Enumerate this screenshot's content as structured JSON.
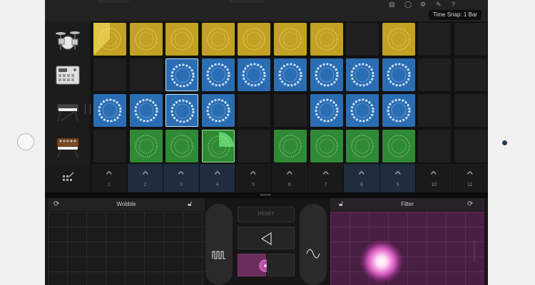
{
  "toolbar": {
    "time_snap_label": "Time Snap: 1 Bar",
    "icons": [
      "mixer-icon",
      "loops-icon",
      "settings-icon",
      "wrench-icon",
      "help-icon"
    ]
  },
  "instruments": [
    {
      "name": "drum-kit"
    },
    {
      "name": "beat-sequencer"
    },
    {
      "name": "electric-piano"
    },
    {
      "name": "synthesizer"
    }
  ],
  "grid": {
    "rows": [
      [
        "yellow-playing",
        "yellow",
        "yellow",
        "yellow",
        "yellow",
        "yellow",
        "yellow",
        "empty",
        "yellow",
        "empty",
        "empty"
      ],
      [
        "empty",
        "empty",
        "blue-playing",
        "blue",
        "blue",
        "blue",
        "blue",
        "blue",
        "blue",
        "empty",
        "empty"
      ],
      [
        "blue",
        "blue",
        "blue-playing",
        "blue",
        "empty",
        "empty",
        "blue",
        "blue",
        "blue",
        "empty",
        "empty"
      ],
      [
        "empty",
        "green",
        "green",
        "green-selected",
        "empty",
        "green",
        "green",
        "green",
        "green",
        "empty",
        "empty"
      ]
    ]
  },
  "triggers": {
    "numbers": [
      "1",
      "2",
      "3",
      "4",
      "5",
      "6",
      "7",
      "8",
      "9",
      "10",
      "11"
    ],
    "highlighted": [
      false,
      true,
      true,
      true,
      false,
      false,
      false,
      true,
      true,
      false,
      false
    ]
  },
  "fx_left": {
    "title": "Wobble"
  },
  "fx_center": {
    "reset_label": "RESET"
  },
  "fx_right": {
    "title": "Filter",
    "side_label": "Resonance"
  },
  "colors": {
    "yellow": "#c3a122",
    "blue": "#2a6db3",
    "green": "#2f8a35",
    "filter_pad": "#4a1f44"
  }
}
